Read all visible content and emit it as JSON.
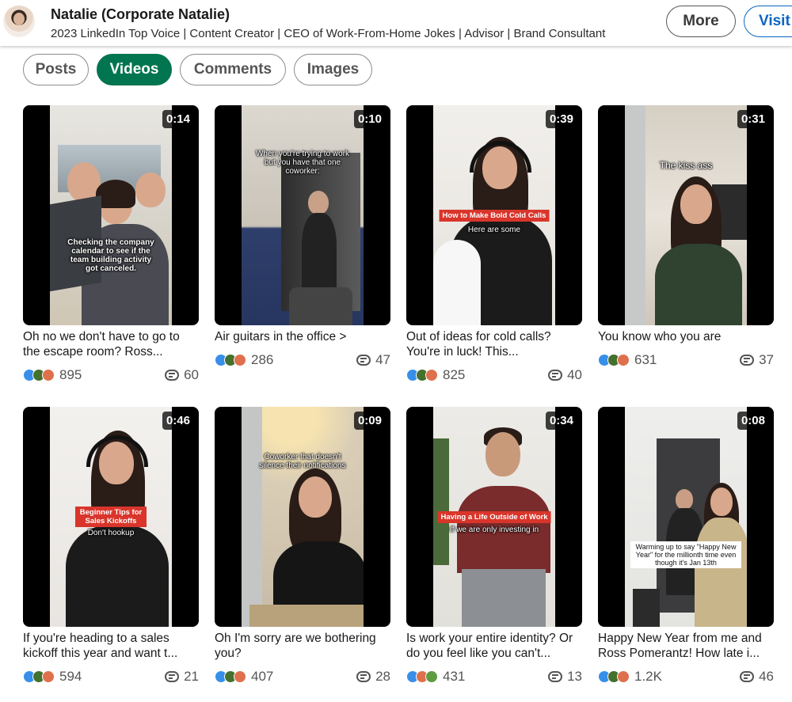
{
  "profile": {
    "name": "Natalie (Corporate Natalie)",
    "headline": "2023 LinkedIn Top Voice | Content Creator | CEO of Work-From-Home Jokes | Advisor | Brand Consultant",
    "more_label": "More",
    "visit_label": "Visit"
  },
  "filters": [
    {
      "label": "Posts",
      "active": false
    },
    {
      "label": "Videos",
      "active": true
    },
    {
      "label": "Comments",
      "active": false
    },
    {
      "label": "Images",
      "active": false
    }
  ],
  "colors": {
    "active_pill": "#01754f",
    "visit": "#0a66c2",
    "like": "#378fe9",
    "celebrate": "#44712e",
    "love": "#df704d"
  },
  "videos": [
    {
      "duration": "0:14",
      "title": "Oh no we don't have to go to the escape room? Ross...",
      "reactions": "895",
      "comments": "60",
      "overlay": "Checking the company calendar to see if the team building activity got canceled.",
      "overlay_style": "plain"
    },
    {
      "duration": "0:10",
      "title": "Air guitars in the office >",
      "reactions": "286",
      "comments": "47",
      "overlay": "When you're trying to work but you have that one coworker:",
      "overlay_style": "plain"
    },
    {
      "duration": "0:39",
      "title": "Out of ideas for cold calls? You're in luck! This...",
      "reactions": "825",
      "comments": "40",
      "overlay": "How to Make Bold Cold Calls",
      "overlay_sub": "Here are some",
      "overlay_style": "red"
    },
    {
      "duration": "0:31",
      "title": "You know who you are",
      "reactions": "631",
      "comments": "37",
      "overlay": "The kiss ass",
      "overlay_style": "plain"
    },
    {
      "duration": "0:46",
      "title": "If you're heading to a sales kickoff this year and want t...",
      "reactions": "594",
      "comments": "21",
      "overlay": "Beginner Tips for Sales Kickoffs",
      "overlay_sub": "Don't hookup",
      "overlay_style": "red"
    },
    {
      "duration": "0:09",
      "title": "Oh I'm sorry are we bothering you?",
      "reactions": "407",
      "comments": "28",
      "overlay": "Coworker that doesn't silence their notifications",
      "overlay_style": "plain"
    },
    {
      "duration": "0:34",
      "title": "Is work your entire identity? Or do you feel like you can't...",
      "reactions": "431",
      "comments": "13",
      "overlay": "Having a Life Outside of Work",
      "overlay_sub": "If we are only investing in",
      "overlay_style": "red"
    },
    {
      "duration": "0:08",
      "title": "Happy New Year from me and Ross Pomerantz! How late i...",
      "reactions": "1.2K",
      "comments": "46",
      "overlay": "Warming up to say \"Happy New Year\" for the millionth time even though it's Jan 13th",
      "overlay_style": "box"
    }
  ]
}
